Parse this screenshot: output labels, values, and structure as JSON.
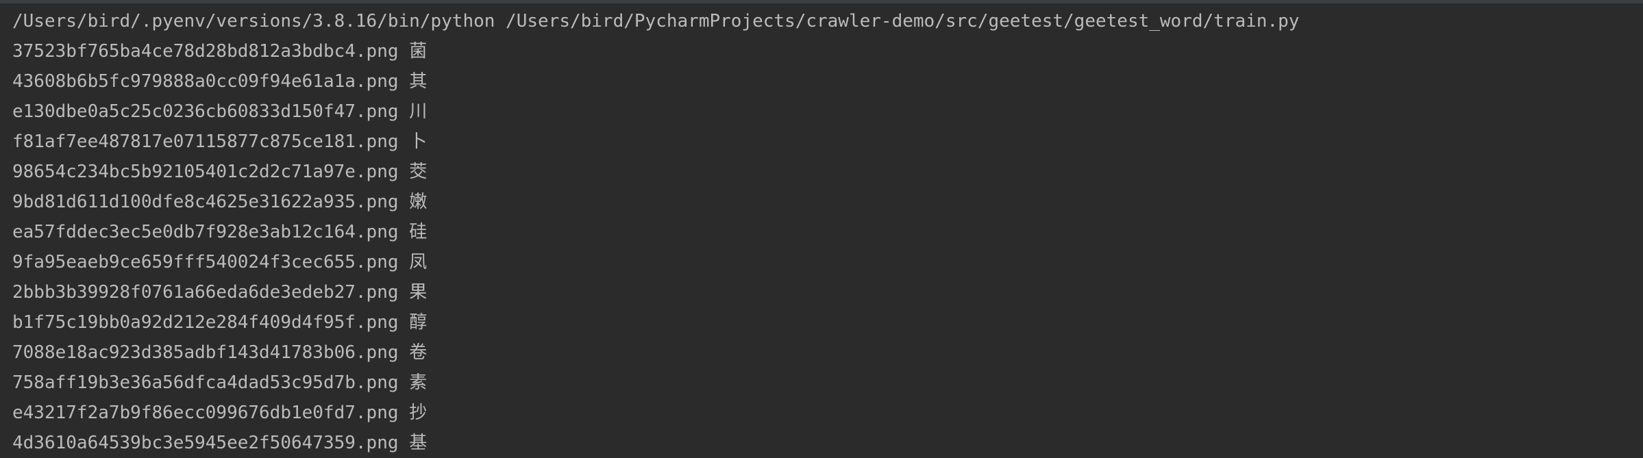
{
  "console": {
    "command": "/Users/bird/.pyenv/versions/3.8.16/bin/python /Users/bird/PycharmProjects/crawler-demo/src/geetest/geetest_word/train.py",
    "lines": [
      {
        "file": "37523bf765ba4ce78d28bd812a3bdbc4.png",
        "char": "菌"
      },
      {
        "file": "43608b6b5fc979888a0cc09f94e61a1a.png",
        "char": "其"
      },
      {
        "file": "e130dbe0a5c25c0236cb60833d150f47.png",
        "char": "川"
      },
      {
        "file": "f81af7ee487817e07115877c875ce181.png",
        "char": "卜"
      },
      {
        "file": "98654c234bc5b92105401c2d2c71a97e.png",
        "char": "茭"
      },
      {
        "file": "9bd81d611d100dfe8c4625e31622a935.png",
        "char": "嫩"
      },
      {
        "file": "ea57fddec3ec5e0db7f928e3ab12c164.png",
        "char": "硅"
      },
      {
        "file": "9fa95eaeb9ce659fff540024f3cec655.png",
        "char": "凤"
      },
      {
        "file": "2bbb3b39928f0761a66eda6de3edeb27.png",
        "char": "果"
      },
      {
        "file": "b1f75c19bb0a92d212e284f409d4f95f.png",
        "char": "醇"
      },
      {
        "file": "7088e18ac923d385adbf143d41783b06.png",
        "char": "卷"
      },
      {
        "file": "758aff19b3e36a56dfca4dad53c95d7b.png",
        "char": "素"
      },
      {
        "file": "e43217f2a7b9f86ecc099676db1e0fd7.png",
        "char": "抄"
      },
      {
        "file": "4d3610a64539bc3e5945ee2f50647359.png",
        "char": "基"
      }
    ]
  }
}
